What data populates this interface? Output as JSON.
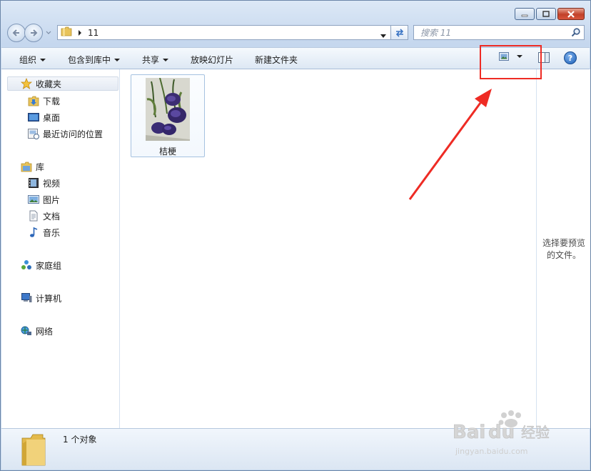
{
  "address": {
    "path": "11"
  },
  "search": {
    "placeholder": "搜索 11"
  },
  "toolbar": {
    "organize": "组织",
    "include_in_library": "包含到库中",
    "share": "共享",
    "slideshow": "放映幻灯片",
    "new_folder": "新建文件夹",
    "help": "?"
  },
  "navpane": {
    "favorites": {
      "label": "收藏夹",
      "items": [
        "下载",
        "桌面",
        "最近访问的位置"
      ]
    },
    "libraries": {
      "label": "库",
      "items": [
        "视频",
        "图片",
        "文档",
        "音乐"
      ]
    },
    "homegroup": "家庭组",
    "computer": "计算机",
    "network": "网络"
  },
  "files": [
    {
      "name": "桔梗",
      "type": "image"
    }
  ],
  "preview": {
    "message": "选择要预览的文件。"
  },
  "details": {
    "count_text": "1 个对象"
  },
  "annotation": {
    "color": "#ee2b24"
  },
  "watermark": {
    "brand": "Baidu经验",
    "url": "jingyan.baidu.com"
  }
}
